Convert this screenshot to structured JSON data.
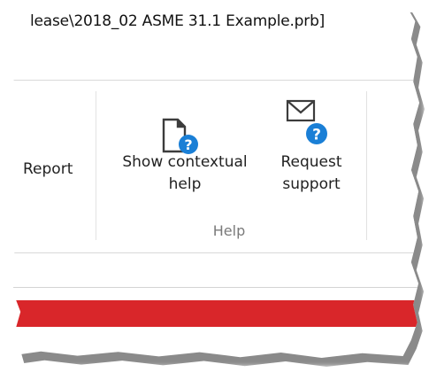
{
  "window": {
    "title": "lease\\2018_02 ASME 31.1 Example.prb]"
  },
  "ribbon": {
    "report_label": "Report",
    "help_group": {
      "label": "Help",
      "contextual_help": {
        "line1": "Show contextual",
        "line2": "help"
      },
      "request_support": {
        "line1": "Request",
        "line2": "support"
      }
    }
  },
  "colors": {
    "accent_blue": "#1a7fd6",
    "status_bar_red": "#d9262a"
  },
  "icons": {
    "contextual_help": "document-question-icon",
    "request_support": "envelope-question-icon"
  }
}
